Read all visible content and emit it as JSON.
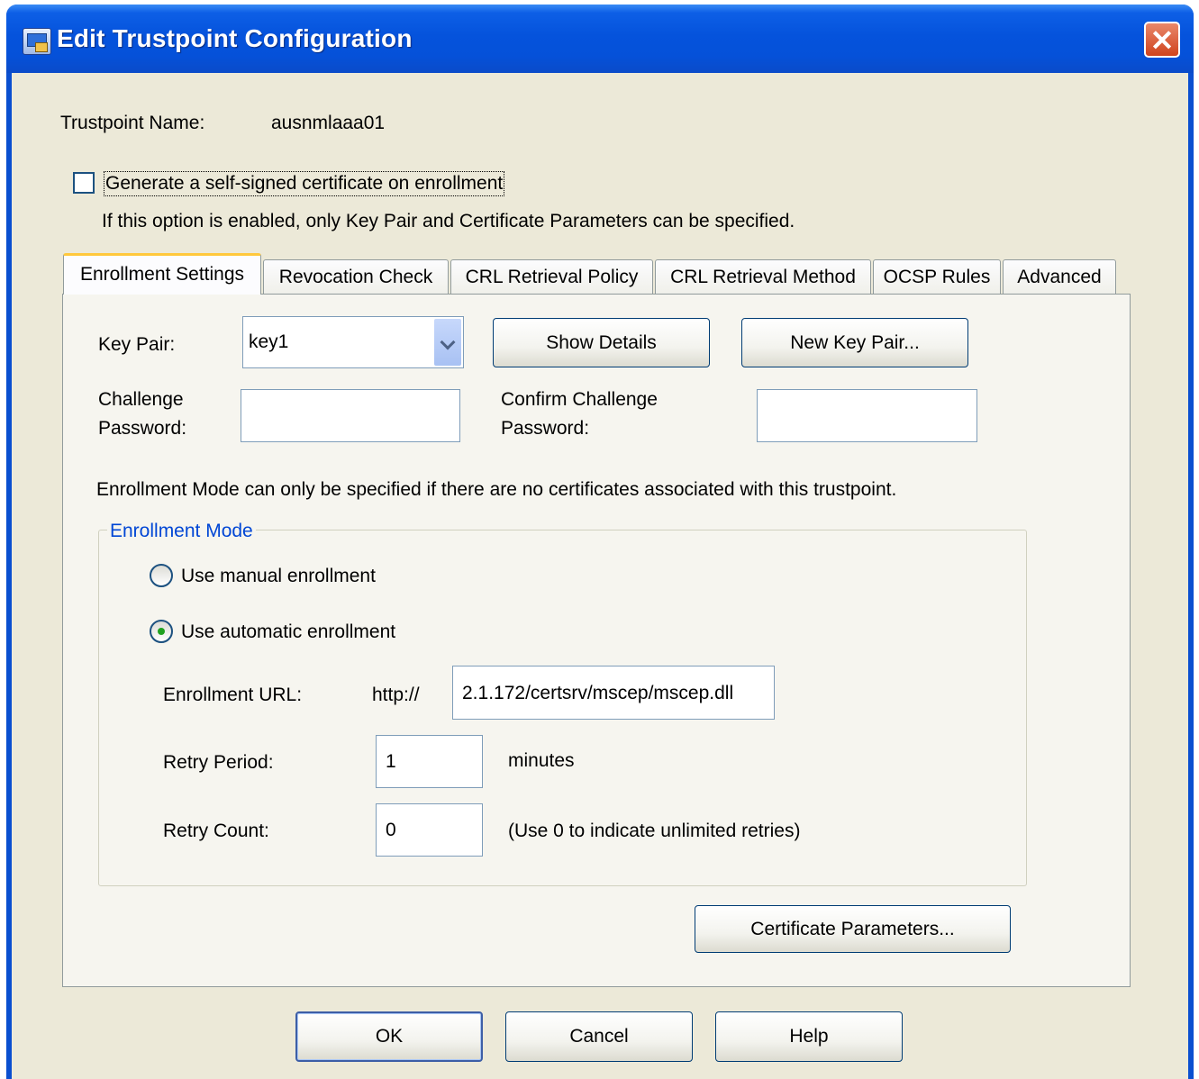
{
  "window": {
    "title": "Edit Trustpoint Configuration",
    "close_glyph": "✕"
  },
  "trustpoint": {
    "name_label": "Trustpoint Name:",
    "name_value": "ausnmlaaa01"
  },
  "self_signed": {
    "label": "Generate a self-signed certificate on enrollment",
    "checked": false,
    "hint": "If this option is enabled, only Key Pair and Certificate Parameters can be specified."
  },
  "tabs": [
    {
      "label": "Enrollment Settings",
      "active": true
    },
    {
      "label": "Revocation Check"
    },
    {
      "label": "CRL Retrieval Policy"
    },
    {
      "label": "CRL Retrieval Method"
    },
    {
      "label": "OCSP Rules"
    },
    {
      "label": "Advanced"
    }
  ],
  "enrollment": {
    "key_pair_label": "Key Pair:",
    "key_pair_value": "key1",
    "show_details": "Show Details",
    "new_key_pair": "New Key Pair...",
    "challenge_label_1": "Challenge",
    "challenge_label_2": "Password:",
    "challenge_value": "",
    "confirm_label_1": "Confirm Challenge",
    "confirm_label_2": "Password:",
    "confirm_value": "",
    "mode_note": "Enrollment Mode can only be specified if there are no certificates associated with this trustpoint.",
    "mode_group_title": "Enrollment Mode",
    "manual_label": "Use manual enrollment",
    "automatic_label": "Use automatic enrollment",
    "selected_mode": "automatic",
    "url_label": "Enrollment URL:",
    "url_prefix": "http://",
    "url_value": "2.1.172/certsrv/mscep/mscep.dll",
    "retry_period_label": "Retry Period:",
    "retry_period_value": "1",
    "retry_period_unit": "minutes",
    "retry_count_label": "Retry Count:",
    "retry_count_value": "0",
    "retry_count_hint": "(Use 0 to indicate unlimited retries)",
    "cert_params_button": "Certificate Parameters..."
  },
  "footer": {
    "ok": "OK",
    "cancel": "Cancel",
    "help": "Help"
  },
  "colors": {
    "titlebar": "#0553dc",
    "dialog_bg": "#ece9d8",
    "group_title": "#0046d5",
    "active_tab_accent": "#ffc83c"
  },
  "icons": {
    "app_icon": "asdm-app-icon",
    "close": "close-icon",
    "dropdown": "chevron-down-icon",
    "cursor": "mouse-pointer-icon"
  }
}
